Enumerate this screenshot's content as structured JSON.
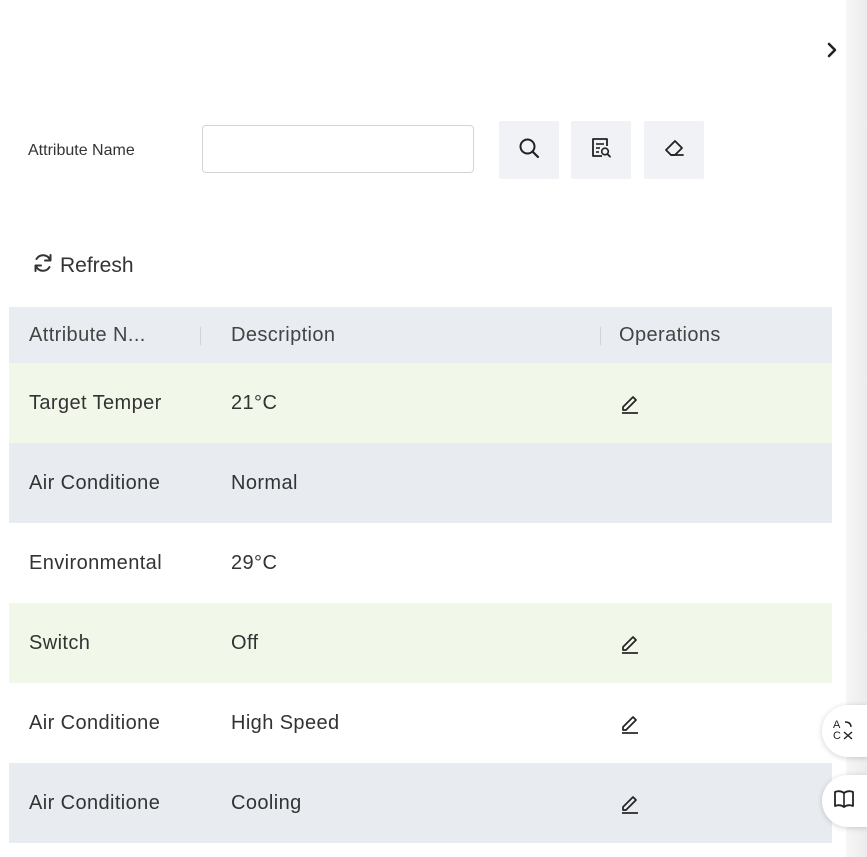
{
  "filter": {
    "label": "Attribute Name",
    "input_value": "",
    "input_placeholder": ""
  },
  "toolbar": {
    "search_icon": "search-icon",
    "advanced_search_icon": "document-search-icon",
    "clear_icon": "eraser-icon"
  },
  "refresh_label": "Refresh",
  "table": {
    "headers": [
      "Attribute N...",
      "Description",
      "Operations"
    ],
    "rows": [
      {
        "name": "Target Temper",
        "description": "21°C",
        "editable": true
      },
      {
        "name": "Air Conditione",
        "description": "Normal",
        "editable": false
      },
      {
        "name": "Environmental",
        "description": "29°C",
        "editable": false
      },
      {
        "name": "Switch",
        "description": "Off",
        "editable": true
      },
      {
        "name": "Air Conditione",
        "description": "High Speed",
        "editable": true
      },
      {
        "name": "Air Conditione",
        "description": "Cooling",
        "editable": true
      }
    ]
  },
  "floating": {
    "translate_icon": "translate-icon",
    "book_icon": "book-icon"
  },
  "colors": {
    "header_bg": "#e9ecf1",
    "row_green": "#f1f8ea",
    "row_gray": "#e8ecf1",
    "tool_btn_bg": "#f0f2f5"
  }
}
